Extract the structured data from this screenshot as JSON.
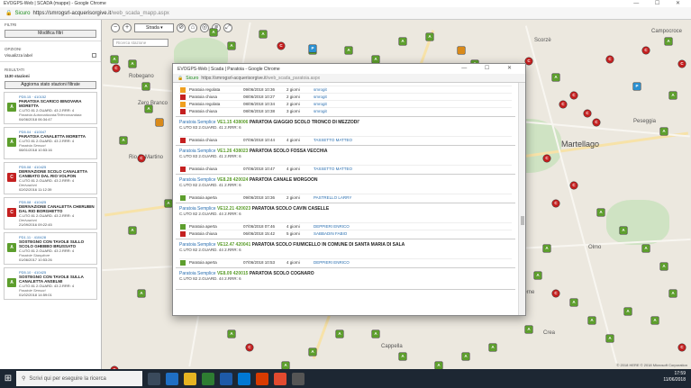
{
  "browser": {
    "title": "EVOGPS-Web | SCADA (mappe) - Google Chrome",
    "secure_label": "Sicuro",
    "url_host": "https://smrogsrl-acquerisorgive.it",
    "url_path": "/web_scada_mapp.aspx",
    "window_controls": "— ☐ ✕"
  },
  "sidebar": {
    "filters_heading": "FILTRI",
    "modify_filters_label": "Modifica filtri",
    "options_heading": "OPZIONI",
    "show_labels_label": "Visualizza label",
    "results_heading": "RISULTATI",
    "station_count": "1130 stazioni",
    "refresh_label": "Aggiorna stato stazioni filtrate",
    "cards": [
      {
        "code": "PD5.15 · 410152",
        "title": "PARATOIA SCARICO BINOVARA MORETTA",
        "line1": "C.UTO 81   2.GUARD. 43   2.RRR: 4",
        "line2": "Paratoia Automatizzata/Telecomandata",
        "line3": "04/06/2018 06:34:47",
        "badge": "A",
        "color": "#5d9e2d"
      },
      {
        "code": "PD5.04 · 410047",
        "title": "PARATOIA CANALETTA MORETTA",
        "line1": "C.UTO 81   2.GUARD. 43   2.RRR: 4",
        "line2": "Paratoia Sensori",
        "line3": "08/01/2018 10:53:16",
        "badge": "A",
        "color": "#5d9e2d"
      },
      {
        "code": "PD5.08 · 410425",
        "title": "DERIVAZIONE SCOLO CANALETTA CANIBATO DAL RIO VOLPON",
        "line1": "C.UTO 81   2.GUARD. 43   2.RRR: 4",
        "line2": "Derivazioni",
        "line3": "02/02/2016 11:12:39",
        "badge": "C",
        "color": "#c42020"
      },
      {
        "code": "PD5.08 · 410425",
        "title": "DERIVAZIONE CANALETTA CHERUBIN DAL RIO BORGHETTO",
        "line1": "C.UTO 81   2.GUARD. 43   2.RRR: 4",
        "line2": "Derivazioni",
        "line3": "21/09/2016 09:22:45",
        "badge": "C",
        "color": "#c42020"
      },
      {
        "code": "PD1.11 · 410428",
        "title": "SOSTEGNO CON TAVOLE SULLO SCOLO GHEBBO BRUSSATO",
        "line1": "C.UTO 81   2.GUARD. 43   2.RRR: 4",
        "line2": "Paratoie Stanpitore",
        "line3": "01/06/2017 10:53:26",
        "badge": "A",
        "color": "#5d9e2d"
      },
      {
        "code": "PD5.10 · 410425",
        "title": "SOSTEGNO CON TAVOLE SULLA CANALETTA ANSELMI",
        "line1": "C.UTO 81   2.GUARD. 43   2.RRR: 4",
        "line2": "Paratoie Sensori",
        "line3": "01/02/2018 14:59:01",
        "badge": "A",
        "color": "#5d9e2d"
      }
    ]
  },
  "map": {
    "mode_label": "Strada",
    "search_placeholder": "Ricerca stazione",
    "places": [
      "Martellago",
      "Scorzè",
      "Zero Branco",
      "Rio S. Martino",
      "Peseggia",
      "Cappella",
      "Campocroce",
      "Olmo",
      "Crea",
      "Maerne",
      "Robegano"
    ],
    "copyright": "© 2018 HERE © 2018 Microsoft Corporation"
  },
  "popup": {
    "title": "EVOGPS-Web | Scada | Paratoia - Google Chrome",
    "secure_label": "Sicuro",
    "url_host": "https://smrogsrl-acquerisorgive.it",
    "url_path": "/web_scada_paratoia.aspx",
    "window_controls": "— ☐ ✕",
    "top_events": [
      {
        "color": "o",
        "state": "Paratoia regolata",
        "date": "09/06/2018 10:36",
        "dur": "2 giorni",
        "op": "smrogit"
      },
      {
        "color": "r",
        "state": "Paratoia chiusa",
        "date": "08/06/2018 10:27",
        "dur": "2 giorni",
        "op": "smrogit"
      },
      {
        "color": "o",
        "state": "Paratoia regolata",
        "date": "08/06/2018 10:34",
        "dur": "2 giorni",
        "op": "smrogit"
      },
      {
        "color": "r",
        "state": "Paratoia chiusa",
        "date": "08/06/2018 10:38",
        "dur": "3 giorni",
        "op": "smrogit"
      }
    ],
    "blocks": [
      {
        "type": "Paratoia Semplice",
        "num": "VE1.15  438006",
        "name": "PARATOIA GIAGGIO SCOLO TRONCO DI MEZZODI'",
        "sub": "C.UTO 83     2.GUARD. 41     2.RRR: 6",
        "events": [
          {
            "color": "r",
            "state": "Paratoia chiusa",
            "date": "07/06/2018 10:44",
            "dur": "4 giorni",
            "op": "TASSETTO MATTEO"
          }
        ]
      },
      {
        "type": "Paratoia Semplice",
        "num": "VE1.26  438023",
        "name": "PARATOIA SCOLO FOSSA VECCHIA",
        "sub": "C.UTO 83     2.GUARD. 41     2.RRR: 6",
        "events": [
          {
            "color": "r",
            "state": "Paratoia chiusa",
            "date": "07/06/2018 10:47",
            "dur": "4 giorni",
            "op": "TASSETTO MATTEO"
          }
        ]
      },
      {
        "type": "Paratoia Semplice",
        "num": "VE8.28  420024",
        "name": "PARATOIA CANALE MORGOON",
        "sub": "C.UTO 82     2.GUARD. 41     2.RRR: 6",
        "events": [
          {
            "color": "g",
            "state": "Paratoia aperta",
            "date": "09/06/2018 10:36",
            "dur": "2 giorni",
            "op": "PASTRELLO LARRY"
          }
        ]
      },
      {
        "type": "Paratoia Semplice",
        "num": "VE12.21  420023",
        "name": "PARATOIA SCOLO CAVIN CASELLE",
        "sub": "C.UTO 82     2.GUARD. 44     2.RRR: 6",
        "events": [
          {
            "color": "g",
            "state": "Paratoia aperta",
            "date": "07/06/2018 07:46",
            "dur": "4 giorni",
            "op": "DEPPIERI ENRICO"
          },
          {
            "color": "r",
            "state": "Paratoia chiusa",
            "date": "06/06/2018 15:42",
            "dur": "5 giorni",
            "op": "SABBADIN FABIO"
          }
        ]
      },
      {
        "type": "Paratoia Semplice",
        "num": "VE12.47  420041",
        "name": "PARATOIA SCOLO FIUMICELLO IN COMUNE DI SANTA MARIA DI SALA",
        "sub": "C.UTO 82     2.GUARD. 44     2.RRR: 6",
        "events": [
          {
            "color": "g",
            "state": "Paratoia aperta",
            "date": "07/06/2018 10:53",
            "dur": "4 giorni",
            "op": "DEPPIERI ENRICO"
          }
        ]
      },
      {
        "type": "Paratoia Semplice",
        "num": "VE8.09  420015",
        "name": "PARATOIA SCOLO COGNARO",
        "sub": "C.UTO 82     2.GUARD. 44     2.RRR: 6",
        "events": []
      }
    ]
  },
  "taskbar": {
    "search_placeholder": "Scrivi qui per eseguire la ricerca",
    "time": "17:59",
    "date": "11/06/2018"
  }
}
